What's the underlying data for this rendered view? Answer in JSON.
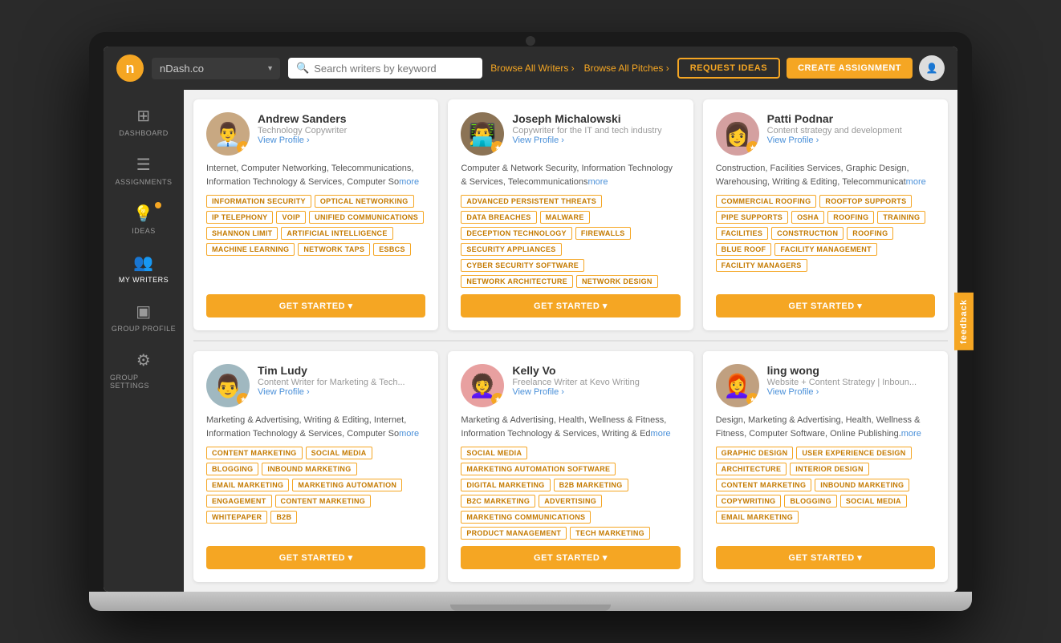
{
  "app": {
    "logo": "n",
    "company": "nDash.co"
  },
  "topbar": {
    "search_placeholder": "Search writers by keyword",
    "browse_writers": "Browse All Writers",
    "browse_pitches": "Browse All Pitches",
    "request_ideas": "REQUEST IDEAS",
    "create_assignment": "CREATE ASSIGNMENT"
  },
  "sidebar": {
    "items": [
      {
        "label": "DASHBOARD",
        "icon": "⊞"
      },
      {
        "label": "ASSIGNMENTS",
        "icon": "☰"
      },
      {
        "label": "IDEAS",
        "icon": "💡",
        "badge": true
      },
      {
        "label": "MY WRITERS",
        "icon": "👥",
        "active": true
      },
      {
        "label": "GROUP PROFILE",
        "icon": "▣"
      },
      {
        "label": "GROUP SETTINGS",
        "icon": "⚙"
      }
    ]
  },
  "writers": [
    {
      "name": "Andrew Sanders",
      "title": "Technology Copywriter",
      "desc": "Internet, Computer Networking, Telecommunications, Information Technology & Services, Computer So",
      "tags": [
        "INFORMATION SECURITY",
        "OPTICAL NETWORKING",
        "IP TELEPHONY",
        "VOIP",
        "UNIFIED COMMUNICATIONS",
        "SHANNON LIMIT",
        "ARTIFICIAL INTELLIGENCE",
        "MACHINE LEARNING",
        "NETWORK TAPS",
        "ESBCS"
      ],
      "btn": "GET STARTED"
    },
    {
      "name": "Joseph Michalowski",
      "title": "Copywriter for the IT and tech industry",
      "desc": "Computer & Network Security, Information Technology & Services, Telecommunications",
      "tags": [
        "ADVANCED PERSISTENT THREATS",
        "DATA BREACHES",
        "MALWARE",
        "DECEPTION TECHNOLOGY",
        "FIREWALLS",
        "SECURITY APPLIANCES",
        "CYBER SECURITY SOFTWARE",
        "NETWORK ARCHITECTURE",
        "NETWORK DESIGN"
      ],
      "btn": "GET STARTED"
    },
    {
      "name": "Patti Podnar",
      "title": "Content strategy and development",
      "desc": "Construction, Facilities Services, Graphic Design, Warehousing, Writing & Editing, Telecommunicat",
      "tags": [
        "COMMERCIAL ROOFING",
        "ROOFTOP SUPPORTS",
        "PIPE SUPPORTS",
        "OSHA",
        "ROOFING",
        "TRAINING",
        "FACILITIES",
        "CONSTRUCTION",
        "ROOFING",
        "BLUE ROOF",
        "FACILITY MANAGEMENT",
        "FACILITY MANAGERS"
      ],
      "btn": "GET STARTED"
    },
    {
      "name": "Tim Ludy",
      "title": "Content Writer for Marketing & Tech...",
      "desc": "Marketing & Advertising, Writing & Editing, Internet, Information Technology & Services, Computer So",
      "tags": [
        "CONTENT MARKETING",
        "SOCIAL MEDIA",
        "BLOGGING",
        "INBOUND MARKETING",
        "EMAIL MARKETING",
        "MARKETING AUTOMATION",
        "ENGAGEMENT",
        "CONTENT MARKETING",
        "WHITEPAPER",
        "B2B"
      ],
      "btn": "GET STARTED"
    },
    {
      "name": "Kelly Vo",
      "title": "Freelance Writer at Kevo Writing",
      "desc": "Marketing & Advertising, Health, Wellness & Fitness, Information Technology & Services, Writing & Ed",
      "tags": [
        "SOCIAL MEDIA",
        "MARKETING AUTOMATION SOFTWARE",
        "DIGITAL MARKETING",
        "B2B MARKETING",
        "B2C MARKETING",
        "ADVERTISING",
        "MARKETING COMMUNICATIONS",
        "PRODUCT MANAGEMENT",
        "TECH MARKETING"
      ],
      "btn": "GET STARTED"
    },
    {
      "name": "ling wong",
      "title": "Website + Content Strategy | Inboun...",
      "desc": "Design, Marketing & Advertising, Health, Wellness & Fitness, Computer Software, Online Publishing.",
      "tags": [
        "GRAPHIC DESIGN",
        "USER EXPERIENCE DESIGN",
        "ARCHITECTURE",
        "INTERIOR DESIGN",
        "CONTENT MARKETING",
        "INBOUND MARKETING",
        "COPYWRITING",
        "BLOGGING",
        "SOCIAL MEDIA",
        "EMAIL MARKETING"
      ],
      "btn": "GET STARTED"
    }
  ],
  "feedback": "feedback"
}
